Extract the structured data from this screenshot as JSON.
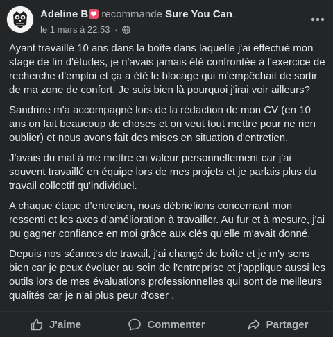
{
  "post": {
    "author": "Adeline B",
    "action": "recommande",
    "page": "Sure You Can",
    "page_suffix": ".",
    "date": "le 1 mars à 22:53",
    "meta_separator": "·",
    "paragraphs": [
      "Ayant travaillé 10 ans dans la boîte dans laquelle j'ai effectué mon stage de fin d'études, je n'avais jamais été confrontée à l'exercice de recherche d'emploi et ça a été le blocage qui m'empêchait de sortir de ma zone de confort. Je suis bien là pourquoi j'irai voir ailleurs?",
      "Sandrine m'a accompagné lors de la rédaction de mon CV (en 10 ans on fait beaucoup de choses et on veut tout mettre pour ne rien oublier) et nous avons fait des mises en situation d'entretien.",
      "J'avais du mal à me mettre en valeur personnellement car j'ai souvent travaillé en équipe lors de mes projets  et je parlais plus du travail collectif qu'individuel.",
      "A chaque étape d'entretien, nous débriefions concernant mon ressenti et les  axes d'amélioration à  travailler. Au fur et à mesure, j'ai pu gagner confiance en moi grâce aux clés qu'elle m'avait donné.",
      "Depuis nos séances de travail, j'ai changé de boîte et je m'y sens bien car je peux évoluer au sein de l'entreprise et j'applique aussi les outils lors de mes évaluations professionnelles qui sont de meilleurs qualités car je n'ai plus peur d'oser ."
    ]
  },
  "actions": {
    "like": "J'aime",
    "comment": "Commenter",
    "share": "Partager"
  },
  "icons": {
    "avatar": "owl-avatar",
    "badge": "heart-badge-icon",
    "privacy": "globe-icon",
    "more": "more-dots-icon",
    "like": "thumbs-up-icon",
    "comment": "speech-bubble-icon",
    "share": "share-arrow-icon"
  },
  "colors": {
    "background": "#242526",
    "text_primary": "#e4e6eb",
    "text_secondary": "#b0b3b8",
    "badge": "#e84a6a"
  }
}
